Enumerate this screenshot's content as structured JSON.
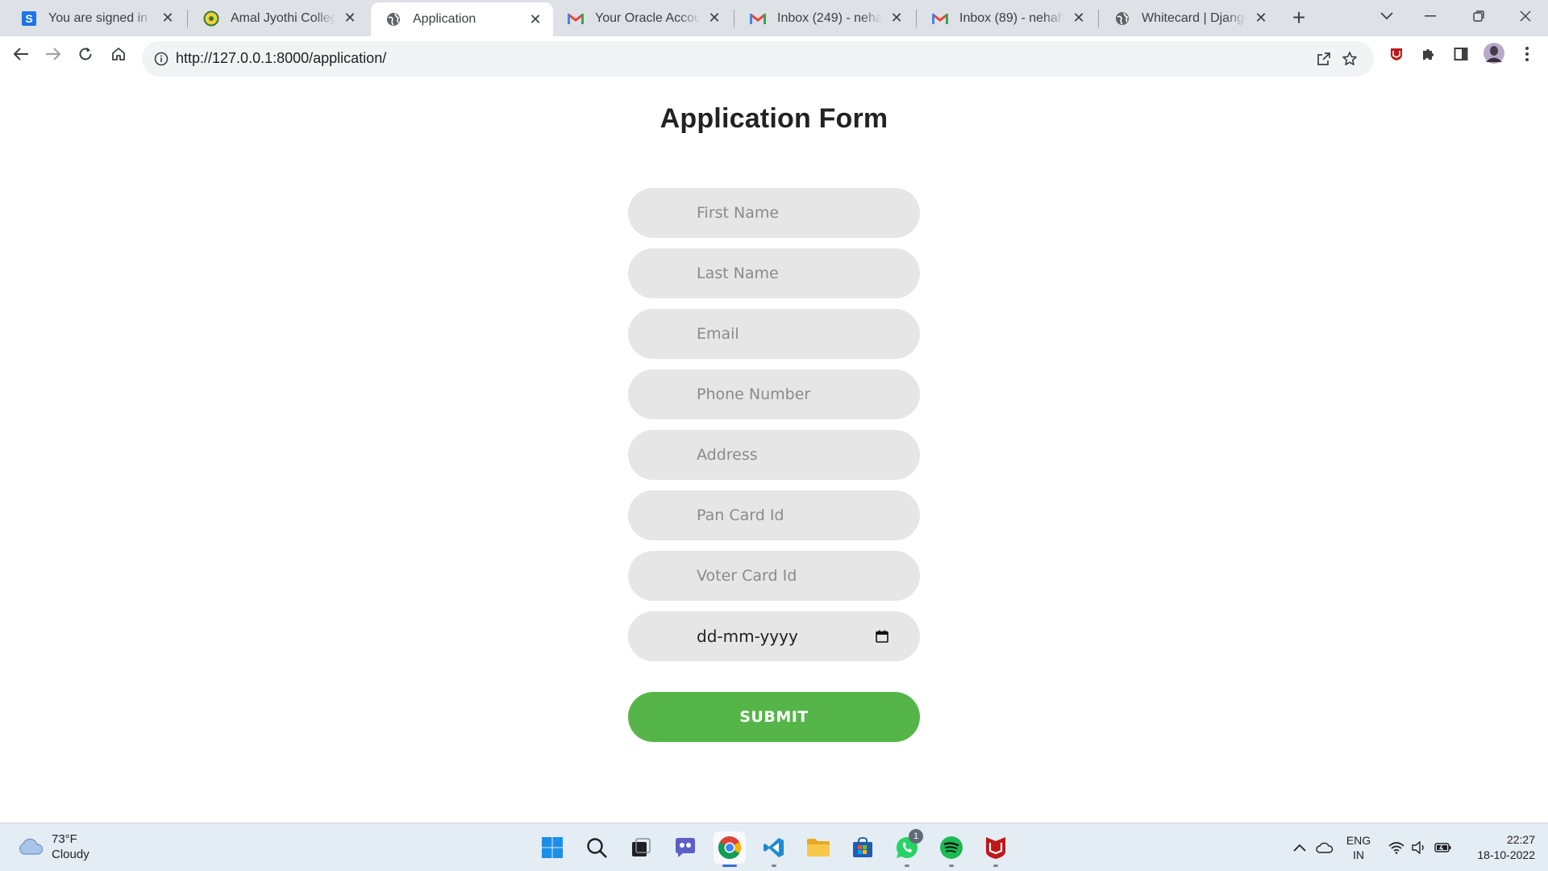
{
  "browser": {
    "tabs": [
      {
        "title": "You are signed in as n",
        "favicon": "s-logo-icon",
        "active": false
      },
      {
        "title": "Amal Jyothi College o",
        "favicon": "college-logo-icon",
        "active": false
      },
      {
        "title": "Application",
        "favicon": "globe-icon",
        "active": true
      },
      {
        "title": "Your Oracle Account -",
        "favicon": "gmail-icon",
        "active": false
      },
      {
        "title": "Inbox (249) - neham2",
        "favicon": "gmail-icon",
        "active": false
      },
      {
        "title": "Inbox (89) - nehahari",
        "favicon": "gmail-icon",
        "active": false
      },
      {
        "title": "Whitecard | Django si",
        "favicon": "globe-icon",
        "active": false
      }
    ],
    "new_tab_label": "+",
    "address": {
      "url": "http://127.0.0.1:8000/application/"
    }
  },
  "form": {
    "title": "Application Form",
    "fields": {
      "first_name": {
        "placeholder": "First Name"
      },
      "last_name": {
        "placeholder": "Last Name"
      },
      "email": {
        "placeholder": "Email"
      },
      "phone": {
        "placeholder": "Phone Number"
      },
      "address": {
        "placeholder": "Address"
      },
      "pan": {
        "placeholder": "Pan Card Id"
      },
      "voter": {
        "placeholder": "Voter Card Id"
      },
      "date": {
        "value": "dd-mm-yyyy"
      }
    },
    "submit_label": "SUBMIT"
  },
  "taskbar": {
    "weather": {
      "temp": "73°F",
      "condition": "Cloudy"
    },
    "apps": [
      "windows-start-icon",
      "search-icon",
      "task-view-icon",
      "teams-chat-icon",
      "chrome-icon",
      "vscode-icon",
      "file-explorer-icon",
      "microsoft-store-icon",
      "whatsapp-icon",
      "spotify-icon",
      "mcafee-icon"
    ],
    "whatsapp_badge": "1",
    "language": {
      "line1": "ENG",
      "line2": "IN"
    },
    "clock": {
      "time": "22:27",
      "date": "18-10-2022"
    }
  },
  "colors": {
    "submit": "#56b548",
    "field_bg": "#e6e6e6",
    "tabstrip": "#dee1e6"
  }
}
